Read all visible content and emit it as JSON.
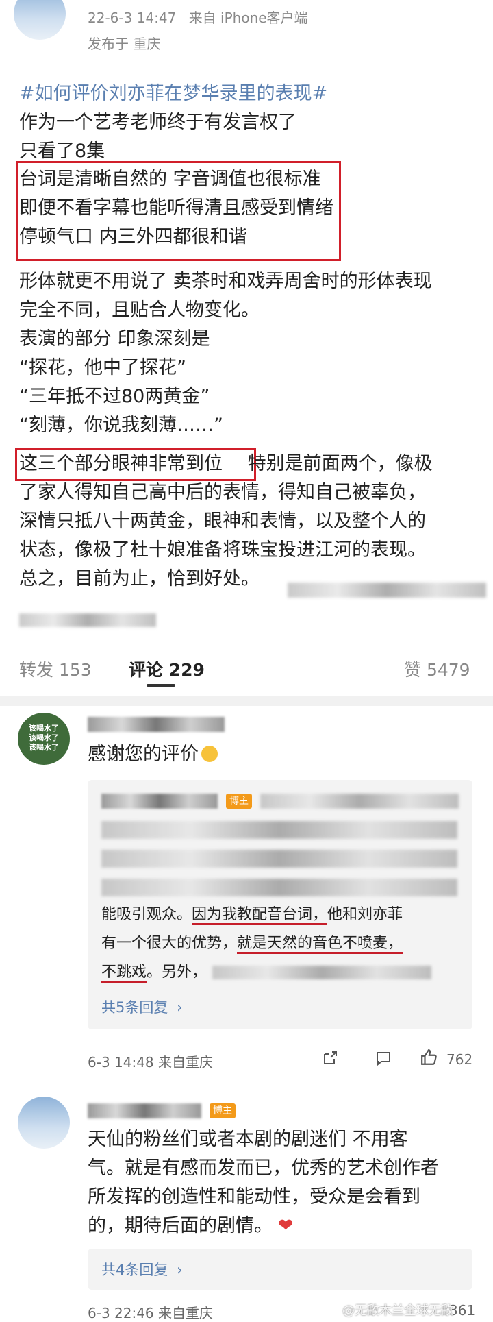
{
  "post": {
    "date": "22-6-3 14:47",
    "source": "来自 iPhone客户端",
    "location": "发布于 重庆",
    "topic": "#如何评价刘亦菲在梦华录里的表现#",
    "lines_before": [
      "作为一个艺考老师终于有发言权了",
      "只看了8集"
    ],
    "boxed_lines": [
      "台词是清晰自然的 字音调值也很标准",
      "即便不看字幕也能听得清且感受到情绪",
      "停顿气口 内三外四都很和谐"
    ],
    "lines_mid": [
      "形体就更不用说了 卖茶时和戏弄周舍时的形体表现",
      "完全不同，且贴合人物变化。",
      "表演的部分 印象深刻是",
      "“探花，他中了探花”",
      "“三年抵不过80两黄金”",
      "“刻薄，你说我刻薄……”"
    ],
    "boxed_inline": "这三个部分眼神非常到位",
    "inline_rest": "特别是前面两个，像极",
    "lines_after": [
      "了家人得知自己高中后的表情，得知自己被辜负，",
      "深情只抵八十两黄金，眼神和表情，以及整个人的",
      "状态，像极了杜十娘准备将珠宝投进江河的表现。",
      "总之，目前为止，恰到好处。"
    ]
  },
  "tabs": {
    "repost": "转发 153",
    "comments": "评论 229",
    "likes": "赞 5479"
  },
  "comment1": {
    "avatar_lines": [
      "该喝水了",
      "该喝水了",
      "该喝水了"
    ],
    "text": "感谢您的评价",
    "quote": {
      "badge": "博主",
      "line_a": "能吸引观众。",
      "line_a_u": "因为我教配音台词，",
      "line_a_tail": "他和刘亦菲",
      "line_b": "有一个很大的优势，",
      "line_b_u": "就是天然的音色不喷麦，",
      "line_c_u": "不跳戏",
      "line_c_tail": "。另外，",
      "replies": "共5条回复",
      "chevron": "›"
    },
    "date": "6-3 14:48 来自重庆",
    "like_count": "762"
  },
  "comment2": {
    "badge": "博主",
    "lines": [
      "天仙的粉丝们或者本剧的剧迷们 不用客",
      "气。就是有感而发而已，优秀的艺术创作者",
      "所发挥的创造性和能动性，受众是会看到",
      "的，期待后面的剧情。"
    ],
    "replies": "共4条回复",
    "chevron": "›",
    "date": "6-3 22:46 来自重庆",
    "like_count": "361"
  },
  "watermark": "@无敌木兰全球无敌",
  "colors": {
    "red": "#d11f2a",
    "link": "#5a7fb0",
    "badge": "#f39a1a"
  }
}
